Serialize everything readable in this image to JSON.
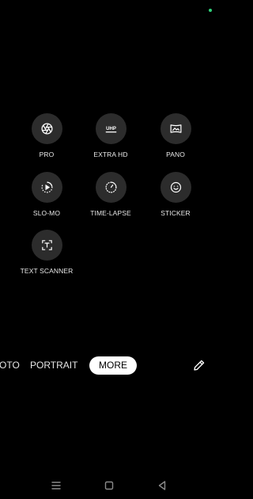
{
  "modes": {
    "pro": "PRO",
    "extra_hd": "EXTRA HD",
    "pano": "PANO",
    "slo_mo": "SLO-MO",
    "time_lapse": "TIME-LAPSE",
    "sticker": "STICKER",
    "text_scanner": "TEXT SCANNER"
  },
  "mode_bar": {
    "photo_partial": "OTO",
    "portrait": "PORTRAIT",
    "more": "MORE"
  },
  "icons": {
    "pro": "aperture-icon",
    "extra_hd": "uhp-icon",
    "pano": "panorama-icon",
    "slo_mo": "slow-motion-icon",
    "time_lapse": "time-lapse-icon",
    "sticker": "smiley-icon",
    "text_scanner": "text-scanner-icon",
    "edit": "pencil-icon",
    "nav_recents": "recents-icon",
    "nav_home": "home-icon",
    "nav_back": "back-icon"
  },
  "uhp_text": "UHP",
  "colors": {
    "background": "#000000",
    "button_bg": "#2c2c2c",
    "selected_bg": "#ffffff",
    "status_dot": "#2fd27a"
  }
}
